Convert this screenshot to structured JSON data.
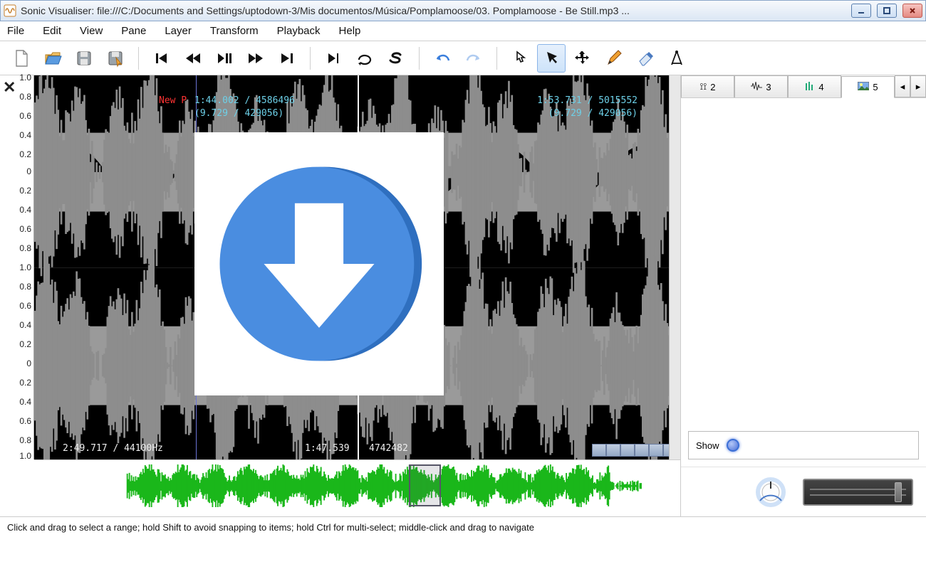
{
  "window": {
    "title": "Sonic Visualiser: file:///C:/Documents and Settings/uptodown-3/Mis documentos/Música/Pomplamoose/03. Pomplamoose - Be Still.mp3 ..."
  },
  "menu": {
    "items": [
      "File",
      "Edit",
      "View",
      "Pane",
      "Layer",
      "Transform",
      "Playback",
      "Help"
    ]
  },
  "ruler": {
    "ticks": [
      "1.0",
      "0.8",
      "0.6",
      "0.4",
      "0.2",
      "0",
      "0.2",
      "0.4",
      "0.6",
      "0.8",
      "1.0",
      "0.8",
      "0.6",
      "0.4",
      "0.2",
      "0",
      "0.2",
      "0.4",
      "0.6",
      "0.8",
      "1.0"
    ]
  },
  "cursor": {
    "new_point_label": "New P",
    "left_top": "1:44.002 / 4586496",
    "left_bottom": "(9.729 / 429056)",
    "right_top": "1:53.731 / 5015552",
    "right_bottom": "(9.729 / 429056)",
    "bottom_left": "2:49.717 / 44100Hz",
    "bottom_mid": "1:47.539",
    "bottom_mid2": "4742482"
  },
  "tabs": {
    "items": [
      {
        "num": "2",
        "icon": "ruler"
      },
      {
        "num": "3",
        "icon": "wave"
      },
      {
        "num": "4",
        "icon": "bars"
      },
      {
        "num": "5",
        "icon": "image"
      }
    ],
    "active": 3
  },
  "show": {
    "label": "Show"
  },
  "status": {
    "text": "Click and drag to select a range; hold Shift to avoid snapping to items; hold Ctrl for multi-select; middle-click and drag to navigate"
  }
}
